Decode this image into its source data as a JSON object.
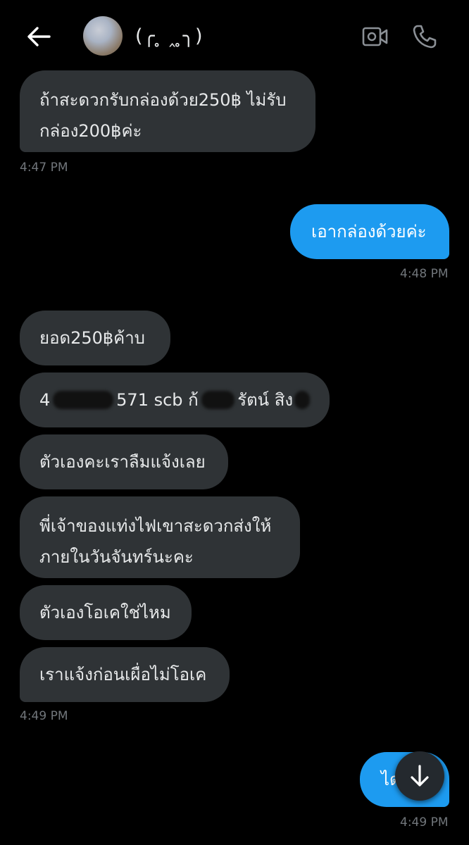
{
  "header": {
    "contact_name": "(╭ ̥ ‸ ̥╮)",
    "icons": {
      "back": "arrow-left-icon",
      "video": "video-call-icon",
      "call": "phone-icon"
    }
  },
  "messages": [
    {
      "direction": "in",
      "lines": [
        "ถ้าสะดวกรับกล่องด้วย250฿ ไม่รับ",
        "กล่อง200฿ค่ะ"
      ]
    },
    {
      "direction": "in_time",
      "text": "4:47 PM"
    },
    {
      "direction": "out",
      "text": "เอากล่องด้วยค่ะ"
    },
    {
      "direction": "out_time",
      "text": "4:48 PM"
    },
    {
      "direction": "in",
      "text": "ยอด250฿ค้าบ"
    },
    {
      "direction": "in",
      "text_start": "4",
      "text_mid": "571 scb ก้",
      "text_end": "รัตน์ สิง"
    },
    {
      "direction": "in",
      "text": "ตัวเองคะเราลืมแจ้งเลย"
    },
    {
      "direction": "in",
      "lines": [
        "พี่เจ้าของแท่งไฟเขาสะดวกส่งให้",
        "ภายในวันจันทร์นะคะ"
      ]
    },
    {
      "direction": "in",
      "text": "ตัวเองโอเคใช่ไหม"
    },
    {
      "direction": "in",
      "text": "เราแจ้งก่อนเผื่อไม่โอเค"
    },
    {
      "direction": "in_time",
      "text": "4:49 PM"
    },
    {
      "direction": "out",
      "text": "ได"
    },
    {
      "direction": "out_time",
      "text": "4:49 PM"
    }
  ],
  "scroll_button": {
    "icon": "arrow-down-icon"
  },
  "colors": {
    "background": "#000000",
    "incoming_bubble": "#2f3336",
    "outgoing_bubble": "#1d9bf0",
    "timestamp": "#71767b"
  }
}
